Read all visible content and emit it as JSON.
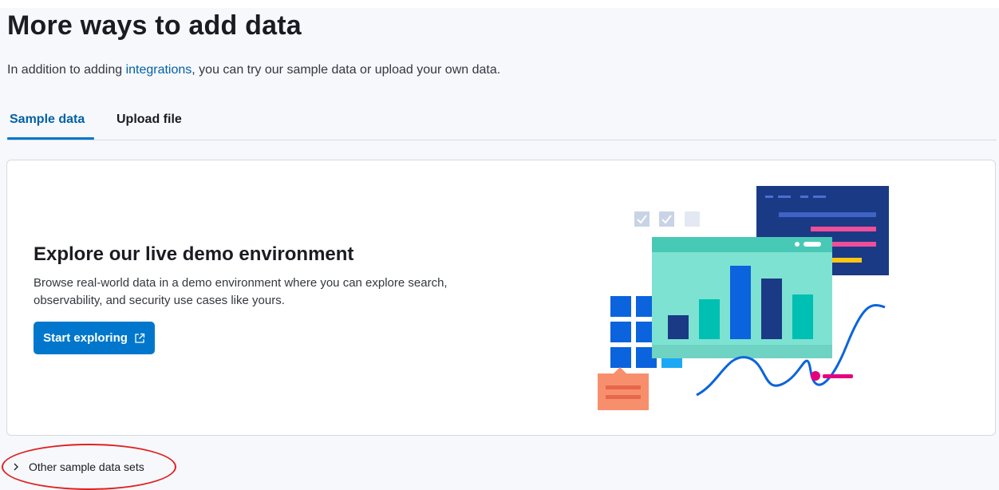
{
  "page": {
    "title": "More ways to add data",
    "intro_before": "In addition to adding ",
    "intro_link": "integrations",
    "intro_after": ", you can try our sample data or upload your own data."
  },
  "tabs": [
    {
      "label": "Sample data",
      "active": true
    },
    {
      "label": "Upload file",
      "active": false
    }
  ],
  "demo_card": {
    "title": "Explore our live demo environment",
    "description": "Browse real-world data in a demo environment where you can explore search, observability, and security use cases like yours.",
    "button_label": "Start exploring",
    "button_icon": "external-link-icon"
  },
  "accordion": {
    "label": "Other sample data sets",
    "icon": "chevron-right-icon",
    "expanded": false
  },
  "colors": {
    "accent": "#0077cc",
    "link": "#0061a6",
    "annotation": "#e02020"
  }
}
